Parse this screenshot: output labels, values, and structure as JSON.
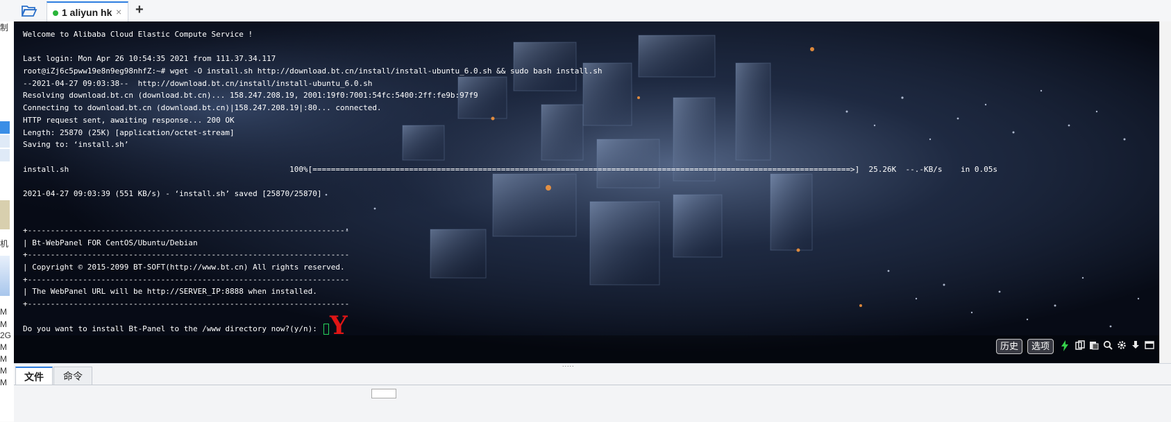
{
  "tabs": {
    "folder_icon": "folder-open-icon",
    "session": {
      "label": "1 aliyun hk",
      "status_color": "#2ab53a",
      "close": "×"
    },
    "add": "+"
  },
  "left_pane": {
    "fragments": [
      "制",
      "机",
      "M",
      "M",
      "2G",
      "M",
      "M",
      "M",
      "M"
    ]
  },
  "terminal": {
    "lines": [
      "Welcome to Alibaba Cloud Elastic Compute Service !",
      "",
      "Last login: Mon Apr 26 10:54:35 2021 from 111.37.34.117",
      "root@iZj6c5pww19e8n9eg98nhfZ:~# wget -O install.sh http://download.bt.cn/install/install-ubuntu_6.0.sh && sudo bash install.sh",
      "--2021-04-27 09:03:38--  http://download.bt.cn/install/install-ubuntu_6.0.sh",
      "Resolving download.bt.cn (download.bt.cn)... 158.247.208.19, 2001:19f0:7001:54fc:5400:2ff:fe9b:97f9",
      "Connecting to download.bt.cn (download.bt.cn)|158.247.208.19|:80... connected.",
      "HTTP request sent, awaiting response... 200 OK",
      "Length: 25870 (25K) [application/octet-stream]",
      "Saving to: ‘install.sh’",
      "",
      "install.sh                                                100%[=====================================================================================================================>]  25.26K  --.-KB/s    in 0.05s",
      "",
      "2021-04-27 09:03:39 (551 KB/s) - ‘install.sh’ saved [25870/25870]",
      "",
      "",
      "+----------------------------------------------------------------------",
      "| Bt-WebPanel FOR CentOS/Ubuntu/Debian",
      "+----------------------------------------------------------------------",
      "| Copyright © 2015-2099 BT-SOFT(http://www.bt.cn) All rights reserved.",
      "+----------------------------------------------------------------------",
      "| The WebPanel URL will be http://SERVER_IP:8888 when installed.",
      "+----------------------------------------------------------------------",
      "",
      "Do you want to install Bt-Panel to the /www directory now?(y/n): "
    ],
    "annotation": "Y",
    "cursor_color": "#27d35a",
    "text_color": "#ffffff",
    "toolbar": {
      "history_label": "历史",
      "options_label": "选项",
      "icons": [
        "lightning-icon",
        "copy-icon",
        "paste-icon",
        "search-icon",
        "gear-icon",
        "download-icon",
        "window-icon"
      ]
    }
  },
  "bottom": {
    "tabs": [
      {
        "label": "文件",
        "active": true
      },
      {
        "label": "命令",
        "active": false
      }
    ],
    "splitter": "....."
  },
  "colors": {
    "accent": "#2f7fe0",
    "annotation": "#e01515"
  }
}
